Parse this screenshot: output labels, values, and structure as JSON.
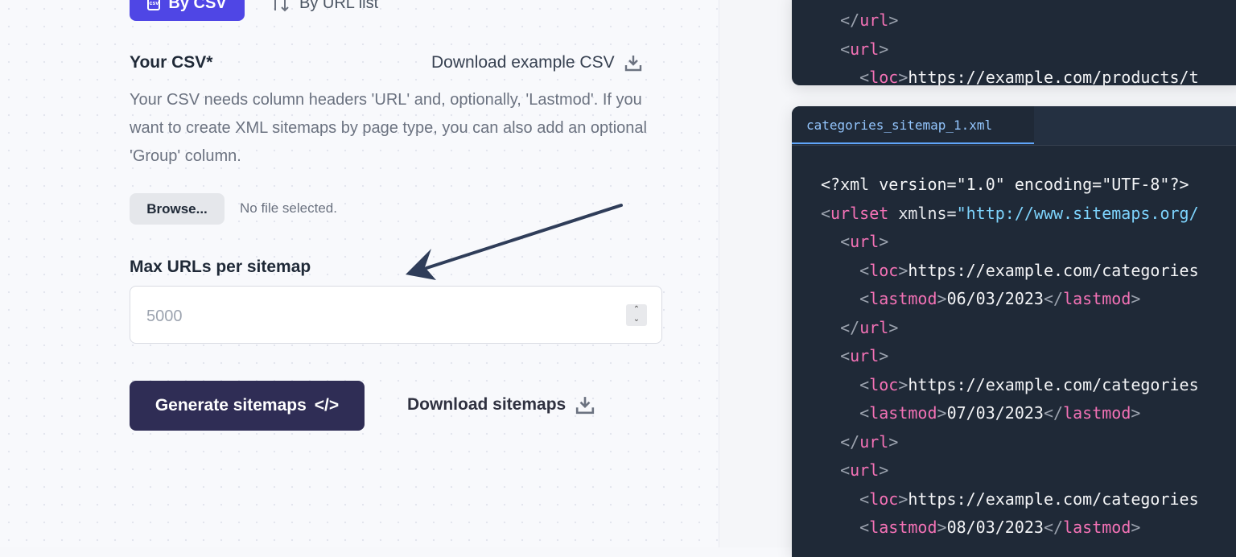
{
  "mode_tabs": {
    "csv": "By CSV",
    "url_list": "By URL list",
    "csv_icon_text": "csv"
  },
  "csv": {
    "label": "Your CSV*",
    "download_example": "Download example CSV",
    "help": "Your CSV needs column headers 'URL' and, optionally, 'Lastmod'. If you want to create XML sitemaps by page type, you can also add an optional 'Group' column.",
    "browse": "Browse...",
    "no_file": "No file selected."
  },
  "max_urls": {
    "label": "Max URLs per sitemap",
    "placeholder": "5000"
  },
  "actions": {
    "generate": "Generate sitemaps",
    "generate_icon": "</>",
    "download": "Download sitemaps"
  },
  "code_top": {
    "lines": [
      "</url>",
      "<url>",
      "<loc>https://example.com/products/t"
    ]
  },
  "code_main": {
    "tab": "categories_sitemap_1.xml",
    "decl": "<?xml version=\"1.0\" encoding=\"UTF-8\"?>",
    "urlset_attr": "xmlns=",
    "urlset_ns": "\"http://www.sitemaps.org/",
    "loc_prefix": "https://example.com/categories",
    "lastmods": [
      "06/03/2023",
      "07/03/2023",
      "08/03/2023"
    ]
  },
  "colors": {
    "accent": "#4f46e5",
    "primary_button": "#2f2d55",
    "code_bg": "#1f2937",
    "tag": "#f472b6",
    "url": "#7dd3fc"
  },
  "icons": [
    "csv-file-icon",
    "sort-arrows-icon",
    "download-icon",
    "code-icon",
    "arrow-annotation"
  ]
}
